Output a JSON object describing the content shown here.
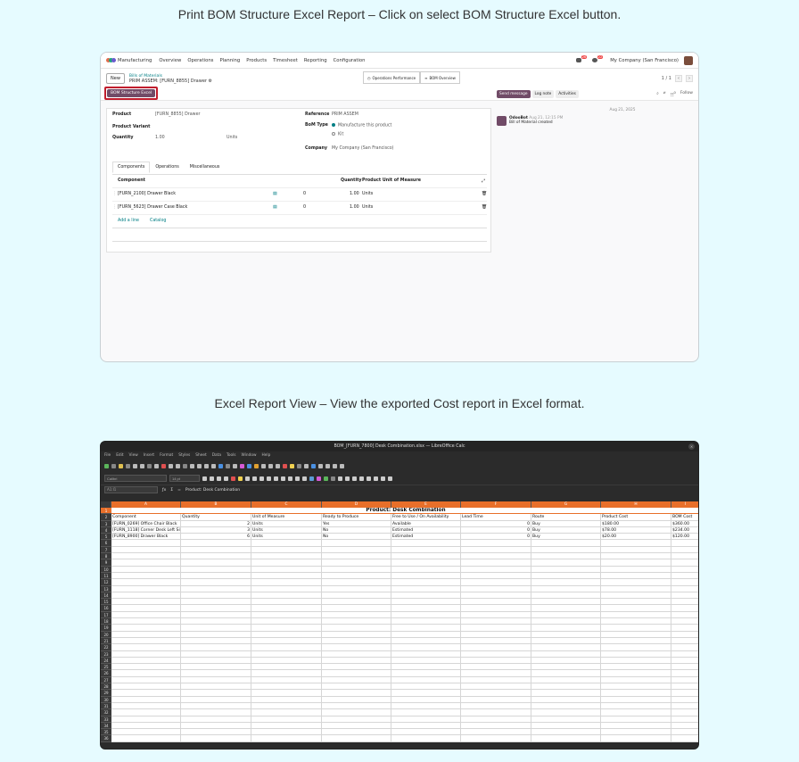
{
  "captions": {
    "top": "Print BOM Structure Excel Report – Click on select BOM Structure Excel button.",
    "bottom": "Excel Report View – View the exported Cost report in Excel format."
  },
  "odoo": {
    "app_name": "Manufacturing",
    "menu": [
      "Overview",
      "Operations",
      "Planning",
      "Products",
      "Timesheet",
      "Reporting",
      "Configuration"
    ],
    "badge_messages": "26",
    "badge_activities": "22",
    "company": "My Company (San Francisco)",
    "new_button": "New",
    "breadcrumb_parent": "Bills of Materials",
    "breadcrumb_current": "PRIM ASSEM: [FURN_8855] Drawer",
    "smart_operations": "Operations Performance",
    "smart_bom_overview": "BOM Overview",
    "pager": "1 / 1",
    "bom_excel_button": "BOM Structure Excel",
    "send_message": "Send message",
    "log_note": "Log note",
    "activities": "Activities",
    "follow": "Follow",
    "followers_count": "0",
    "fields": {
      "product_label": "Product",
      "product_value": "[FURN_8855] Drawer",
      "variant_label": "Product Variant",
      "quantity_label": "Quantity",
      "quantity_value": "1.00",
      "quantity_uom": "Units",
      "reference_label": "Reference",
      "reference_value": "PRIM ASSEM",
      "bom_type_label": "BoM Type",
      "bom_type_manufacture": "Manufacture this product",
      "bom_type_kit": "Kit",
      "company_label": "Company",
      "company_value": "My Company (San Francisco)"
    },
    "tabs": [
      "Components",
      "Operations",
      "Miscellaneous"
    ],
    "table_headers": {
      "component": "Component",
      "quantity": "Quantity",
      "uom": "Product Unit of Measure"
    },
    "lines": [
      {
        "component": "[FURN_2100] Drawer Black",
        "zero": "0",
        "qty": "1.00",
        "uom": "Units"
      },
      {
        "component": "[FURN_5623] Drawer Case Black",
        "zero": "0",
        "qty": "1.00",
        "uom": "Units"
      }
    ],
    "add_line": "Add a line",
    "catalog": "Catalog",
    "chatter_date": "Aug 21, 2025",
    "chatter_author": "OdooBot",
    "chatter_time": "Aug 21, 12:15 PM",
    "chatter_text": "Bill of Material created"
  },
  "calc": {
    "window_title": "BOM_[FURN_7800] Desk Combination.xlsx — LibreOffice Calc",
    "menu": [
      "File",
      "Edit",
      "View",
      "Insert",
      "Format",
      "Styles",
      "Sheet",
      "Data",
      "Tools",
      "Window",
      "Help"
    ],
    "font_name": "Calibri",
    "font_size": "14 pt",
    "name_box": "A1:I1",
    "formula": "Product: Desk Combination",
    "columns": [
      "A",
      "B",
      "C",
      "D",
      "E",
      "F",
      "G",
      "H",
      "I"
    ],
    "title_row": "Product: Desk Combination",
    "headers": [
      "Component",
      "Quantity",
      "Unit of Measure",
      "Ready to Produce",
      "Free to Use / On Availability",
      "Lead Time",
      "Route",
      "Product Cost",
      "BOM Cost"
    ],
    "rows": [
      [
        "[FURN_0269] Office Chair Black",
        "2",
        "Units",
        "Yes",
        "Available",
        "0",
        "Buy",
        "$180.00",
        "$360.00"
      ],
      [
        "[FURN_1118] Corner Desk Left Sit",
        "3",
        "Units",
        "No",
        "Estimated",
        "0",
        "Buy",
        "$78.00",
        "$234.00"
      ],
      [
        "[FURN_8900] Drawer Black",
        "6",
        "Units",
        "No",
        "Estimated",
        "0",
        "Buy",
        "$20.00",
        "$120.00"
      ]
    ],
    "row_numbers": [
      "1",
      "2",
      "3",
      "4",
      "5",
      "6",
      "7",
      "8",
      "9",
      "10",
      "11",
      "12",
      "13",
      "14",
      "15",
      "16",
      "17",
      "18",
      "19",
      "20",
      "21",
      "22",
      "23",
      "24",
      "25",
      "26",
      "27",
      "28",
      "29",
      "30",
      "31",
      "32",
      "33",
      "34",
      "35",
      "36"
    ]
  }
}
